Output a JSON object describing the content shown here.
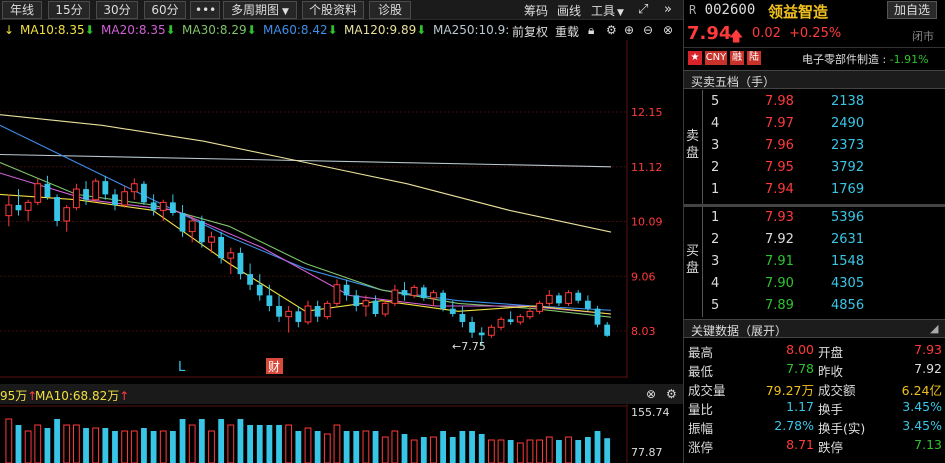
{
  "toolbar": {
    "periods": [
      "年线",
      "15分",
      "30分",
      "60分",
      "•••"
    ],
    "multi_period": "多周期图",
    "stock_info": "个股资料",
    "diagnose": "诊股",
    "chips": "筹码",
    "draw": "画线",
    "tools": "工具"
  },
  "ma_row": {
    "ma10": "MA10:8.35",
    "ma20": "MA20:8.35",
    "ma30": "MA30:8.29",
    "ma60": "MA60:8.42",
    "ma120": "MA120:9.89",
    "ma250": "MA250:10.9:",
    "adjust": "前复权",
    "overlay": "重载"
  },
  "chart_data": {
    "type": "candlestick",
    "y_ticks": [
      "12.15",
      "11.12",
      "10.09",
      "9.06",
      "8.03"
    ],
    "ylim": [
      7.6,
      12.9
    ],
    "low_annotation": "←7.75",
    "marker_L": "L",
    "marker_fin": "财",
    "ohlc": [
      [
        10.2,
        10.6,
        10.0,
        10.4
      ],
      [
        10.4,
        10.7,
        10.2,
        10.3
      ],
      [
        10.3,
        10.5,
        10.1,
        10.45
      ],
      [
        10.45,
        10.9,
        10.4,
        10.8
      ],
      [
        10.8,
        10.95,
        10.5,
        10.55
      ],
      [
        10.55,
        10.6,
        10.0,
        10.1
      ],
      [
        10.1,
        10.4,
        9.9,
        10.35
      ],
      [
        10.35,
        10.8,
        10.3,
        10.7
      ],
      [
        10.7,
        10.85,
        10.4,
        10.5
      ],
      [
        10.5,
        10.9,
        10.45,
        10.85
      ],
      [
        10.85,
        10.95,
        10.5,
        10.6
      ],
      [
        10.6,
        10.7,
        10.3,
        10.4
      ],
      [
        10.4,
        10.75,
        10.35,
        10.65
      ],
      [
        10.65,
        10.9,
        10.5,
        10.8
      ],
      [
        10.8,
        10.85,
        10.4,
        10.45
      ],
      [
        10.45,
        10.6,
        10.2,
        10.3
      ],
      [
        10.3,
        10.5,
        10.1,
        10.45
      ],
      [
        10.45,
        10.6,
        10.2,
        10.25
      ],
      [
        10.25,
        10.4,
        9.8,
        9.9
      ],
      [
        9.9,
        10.2,
        9.7,
        10.1
      ],
      [
        10.1,
        10.2,
        9.6,
        9.7
      ],
      [
        9.7,
        9.9,
        9.5,
        9.8
      ],
      [
        9.8,
        9.9,
        9.3,
        9.4
      ],
      [
        9.4,
        9.6,
        9.1,
        9.5
      ],
      [
        9.5,
        9.6,
        9.0,
        9.1
      ],
      [
        9.1,
        9.3,
        8.8,
        8.9
      ],
      [
        8.9,
        9.1,
        8.6,
        8.7
      ],
      [
        8.7,
        8.9,
        8.4,
        8.5
      ],
      [
        8.5,
        8.7,
        8.2,
        8.3
      ],
      [
        8.3,
        8.5,
        8.0,
        8.4
      ],
      [
        8.4,
        8.5,
        8.1,
        8.2
      ],
      [
        8.2,
        8.6,
        8.15,
        8.5
      ],
      [
        8.5,
        8.6,
        8.2,
        8.3
      ],
      [
        8.3,
        8.6,
        8.25,
        8.55
      ],
      [
        8.55,
        9.0,
        8.5,
        8.9
      ],
      [
        8.9,
        9.0,
        8.6,
        8.7
      ],
      [
        8.7,
        8.8,
        8.4,
        8.5
      ],
      [
        8.5,
        8.7,
        8.3,
        8.6
      ],
      [
        8.6,
        8.7,
        8.3,
        8.35
      ],
      [
        8.35,
        8.6,
        8.3,
        8.55
      ],
      [
        8.55,
        8.9,
        8.5,
        8.8
      ],
      [
        8.8,
        8.95,
        8.6,
        8.7
      ],
      [
        8.7,
        8.9,
        8.65,
        8.85
      ],
      [
        8.85,
        8.9,
        8.6,
        8.65
      ],
      [
        8.65,
        8.8,
        8.5,
        8.75
      ],
      [
        8.75,
        8.8,
        8.4,
        8.45
      ],
      [
        8.45,
        8.6,
        8.3,
        8.35
      ],
      [
        8.35,
        8.5,
        8.1,
        8.2
      ],
      [
        8.2,
        8.3,
        7.9,
        8.0
      ],
      [
        8.0,
        8.1,
        7.75,
        7.95
      ],
      [
        7.95,
        8.15,
        7.9,
        8.1
      ],
      [
        8.1,
        8.3,
        8.05,
        8.25
      ],
      [
        8.25,
        8.4,
        8.15,
        8.2
      ],
      [
        8.2,
        8.35,
        8.15,
        8.3
      ],
      [
        8.3,
        8.5,
        8.25,
        8.4
      ],
      [
        8.4,
        8.6,
        8.35,
        8.55
      ],
      [
        8.55,
        8.8,
        8.5,
        8.7
      ],
      [
        8.7,
        8.75,
        8.5,
        8.55
      ],
      [
        8.55,
        8.8,
        8.5,
        8.75
      ],
      [
        8.75,
        8.8,
        8.55,
        8.6
      ],
      [
        8.6,
        8.7,
        8.4,
        8.45
      ],
      [
        8.45,
        8.5,
        8.1,
        8.15
      ],
      [
        8.15,
        8.2,
        7.92,
        7.94
      ]
    ],
    "ma_lines": [
      {
        "name": "MA250",
        "color": "#b9c7cf",
        "values": [
          11.35,
          11.12
        ]
      },
      {
        "name": "MA120",
        "color": "#e8e09a",
        "values": [
          12.1,
          11.9,
          11.6,
          11.2,
          10.8,
          10.3,
          9.89
        ]
      },
      {
        "name": "MA60",
        "color": "#3c8ee8",
        "values": [
          11.9,
          11.2,
          10.5,
          9.8,
          9.2,
          8.8,
          8.6,
          8.5,
          8.42
        ]
      },
      {
        "name": "MA30",
        "color": "#7fc36a",
        "values": [
          11.2,
          10.6,
          10.4,
          10.0,
          9.3,
          8.8,
          8.55,
          8.45,
          8.29
        ]
      },
      {
        "name": "MA20",
        "color": "#d35fd8",
        "values": [
          11.0,
          10.5,
          10.3,
          9.6,
          8.7,
          8.5,
          8.5,
          8.35
        ]
      },
      {
        "name": "MA10",
        "color": "#f0e040",
        "values": [
          10.6,
          10.5,
          10.3,
          9.3,
          8.4,
          8.6,
          8.4,
          8.5,
          8.35
        ]
      }
    ]
  },
  "lower_panel": {
    "label_left": "95万",
    "ma10": "MA10:68.82万",
    "y_ticks": [
      "155.74",
      "77.87"
    ]
  },
  "quote": {
    "prefix": "R",
    "code": "002600",
    "name": "领益智造",
    "add_watch": "加自选",
    "price": "7.94",
    "change": "0.02",
    "pct": "+0.25%",
    "market": "闭市",
    "tags": [
      "CNY",
      "融",
      "陆"
    ],
    "sector": "电子零部件制造",
    "sector_pct": "-1.91%"
  },
  "orderbook": {
    "title": "买卖五档（手）",
    "sell_label": "卖盘",
    "buy_label": "买盘",
    "sells": [
      {
        "lvl": "5",
        "price": "7.98",
        "vol": "2138"
      },
      {
        "lvl": "4",
        "price": "7.97",
        "vol": "2490"
      },
      {
        "lvl": "3",
        "price": "7.96",
        "vol": "2373"
      },
      {
        "lvl": "2",
        "price": "7.95",
        "vol": "3792"
      },
      {
        "lvl": "1",
        "price": "7.94",
        "vol": "1769"
      }
    ],
    "buys": [
      {
        "lvl": "1",
        "price": "7.93",
        "vol": "5396"
      },
      {
        "lvl": "2",
        "price": "7.92",
        "vol": "2631"
      },
      {
        "lvl": "3",
        "price": "7.91",
        "vol": "1548"
      },
      {
        "lvl": "4",
        "price": "7.90",
        "vol": "4305"
      },
      {
        "lvl": "5",
        "price": "7.89",
        "vol": "4856"
      }
    ]
  },
  "key_data": {
    "title": "关键数据（展开）",
    "rows": [
      {
        "l1": "最高",
        "v1": "8.00",
        "c1": "up",
        "l2": "开盘",
        "v2": "7.93",
        "c2": "up"
      },
      {
        "l1": "最低",
        "v1": "7.78",
        "c1": "down",
        "l2": "昨收",
        "v2": "7.92",
        "c2": "neutral"
      },
      {
        "l1": "成交量",
        "v1": "79.27万",
        "c1": "yellow",
        "l2": "成交额",
        "v2": "6.24亿",
        "c2": "yellow"
      },
      {
        "l1": "量比",
        "v1": "1.17",
        "c1": "cyan",
        "l2": "换手",
        "v2": "3.45%",
        "c2": "cyan"
      },
      {
        "l1": "振幅",
        "v1": "2.78%",
        "c1": "cyan",
        "l2": "换手(实)",
        "v2": "3.45%",
        "c2": "cyan"
      },
      {
        "l1": "涨停",
        "v1": "8.71",
        "c1": "up",
        "l2": "跌停",
        "v2": "7.13",
        "c2": "down"
      }
    ]
  }
}
